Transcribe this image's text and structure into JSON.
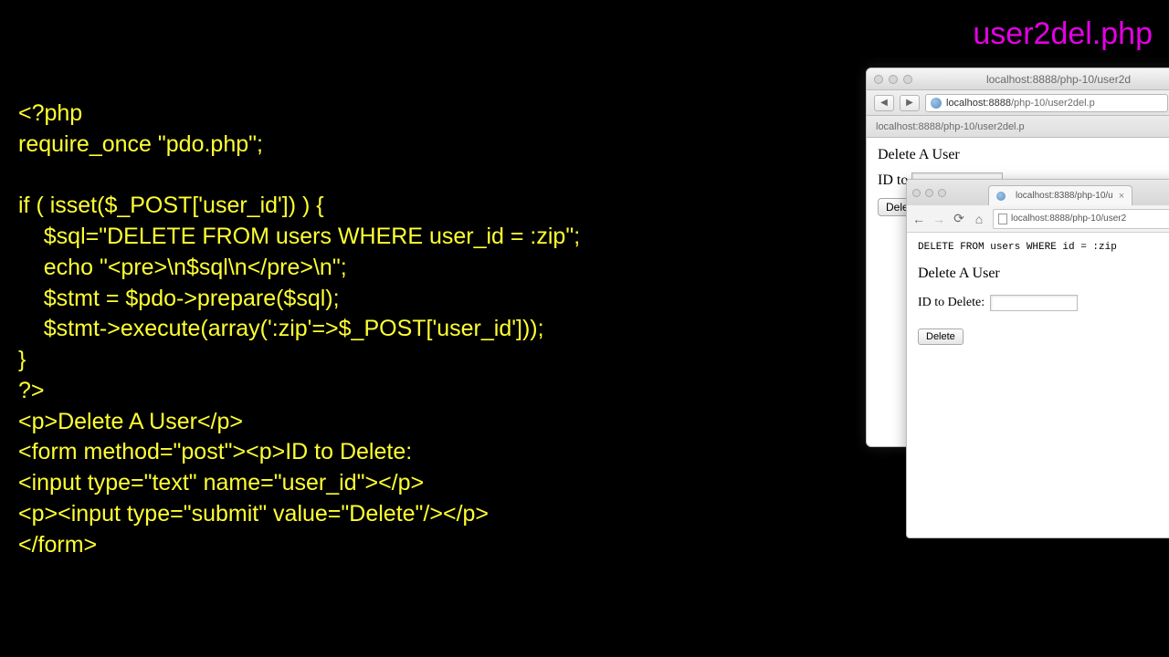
{
  "title": "user2del.php",
  "code": "<?php\nrequire_once \"pdo.php\";\n\nif ( isset($_POST['user_id']) ) {\n    $sql=\"DELETE FROM users WHERE user_id = :zip\";\n    echo \"<pre>\\n$sql\\n</pre>\\n\";\n    $stmt = $pdo->prepare($sql);\n    $stmt->execute(array(':zip'=>$_POST['user_id']));\n}\n?>\n<p>Delete A User</p>\n<form method=\"post\"><p>ID to Delete:\n<input type=\"text\" name=\"user_id\"></p>\n<p><input type=\"submit\" value=\"Delete\"/></p>\n</form>",
  "mac_window": {
    "title": "localhost:8888/php-10/user2d",
    "url_host": "localhost:8888",
    "url_path": "/php-10/user2del.p",
    "tab": "localhost:8888/php-10/user2del.p",
    "heading": "Delete A User",
    "label": "ID to",
    "button": "Dele"
  },
  "chrome_window": {
    "tab": "localhost:8388/php-10/u",
    "url": "localhost:8888/php-10/user2",
    "sql": "DELETE FROM users WHERE id = :zip",
    "heading": "Delete A User",
    "label": "ID to Delete:",
    "button": "Delete"
  },
  "glyphs": {
    "back": "◀",
    "fwd": "▶",
    "left": "←",
    "right": "→",
    "reload": "⟳",
    "home": "⌂",
    "close": "×"
  }
}
